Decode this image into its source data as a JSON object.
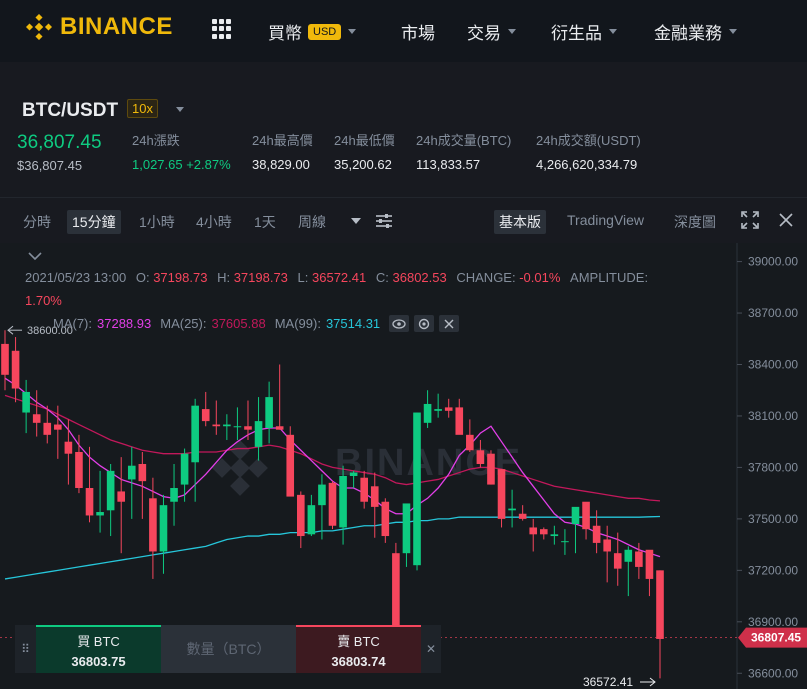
{
  "header": {
    "brand": "BINANCE",
    "nav": [
      {
        "label": "買幣",
        "badge": "USD",
        "has_caret": true
      },
      {
        "label": "市場",
        "has_caret": false
      },
      {
        "label": "交易",
        "has_caret": true
      },
      {
        "label": "衍生品",
        "has_caret": true
      },
      {
        "label": "金融業務",
        "has_caret": true
      }
    ]
  },
  "ticker": {
    "pair": "BTC/USDT",
    "leverage": "10x",
    "last_price": "36,807.45",
    "last_price_usd": "$36,807.45",
    "stats": [
      {
        "label": "24h漲跌",
        "value": "1,027.65 +2.87%",
        "color": "#0ecb81"
      },
      {
        "label": "24h最高價",
        "value": "38,829.00"
      },
      {
        "label": "24h最低價",
        "value": "35,200.62"
      },
      {
        "label": "24h成交量(BTC)",
        "value": "113,833.57"
      },
      {
        "label": "24h成交額(USDT)",
        "value": "4,266,620,334.79"
      }
    ]
  },
  "toolbar": {
    "intervals": [
      "分時",
      "15分鐘",
      "1小時",
      "4小時",
      "1天",
      "周線"
    ],
    "active_interval": "15分鐘",
    "views": [
      "基本版",
      "TradingView",
      "深度圖"
    ],
    "active_view": "基本版"
  },
  "ohlc": {
    "datetime": "2021/05/23 13:00",
    "o_label": "O:",
    "o": "37198.73",
    "h_label": "H:",
    "h": "37198.73",
    "l_label": "L:",
    "l": "36572.41",
    "c_label": "C:",
    "c": "36802.53",
    "change_label": "CHANGE:",
    "change": "-0.01%",
    "amplitude_label": "AMPLITUDE:",
    "amplitude": "1.70%"
  },
  "ma": [
    {
      "label": "MA(7):",
      "value": "37288.93",
      "color": "#e23fe8"
    },
    {
      "label": "MA(25):",
      "value": "37605.88",
      "color": "#c2185b"
    },
    {
      "label": "MA(99):",
      "value": "37514.31",
      "color": "#26c6da"
    }
  ],
  "chart_data": {
    "type": "candlestick",
    "y_ticks": [
      "39000.00",
      "38700.00",
      "38400.00",
      "38100.00",
      "37800.00",
      "37500.00",
      "37200.00",
      "36900.00",
      "36600.00"
    ],
    "ylim": [
      36450,
      39050
    ],
    "current_price_label": "36807.45",
    "high_marker": "38600.00",
    "low_marker": "36572.41",
    "watermark": "BINANCE",
    "candles": [
      [
        38520,
        38600,
        38250,
        38340
      ],
      [
        38480,
        38560,
        38180,
        38260
      ],
      [
        38120,
        38310,
        38000,
        38240
      ],
      [
        38110,
        38250,
        37980,
        38060
      ],
      [
        38060,
        38160,
        37940,
        37990
      ],
      [
        38050,
        38160,
        37850,
        38020
      ],
      [
        37950,
        38080,
        37700,
        37880
      ],
      [
        37890,
        37990,
        37650,
        37680
      ],
      [
        37680,
        37920,
        37480,
        37520
      ],
      [
        37520,
        37780,
        37420,
        37540
      ],
      [
        37550,
        37820,
        37400,
        37780
      ],
      [
        37660,
        37860,
        37300,
        37600
      ],
      [
        37730,
        37920,
        37500,
        37810
      ],
      [
        37820,
        37890,
        37500,
        37720
      ],
      [
        37620,
        37740,
        37150,
        37310
      ],
      [
        37310,
        37640,
        37180,
        37580
      ],
      [
        37600,
        37820,
        37460,
        37680
      ],
      [
        37700,
        37910,
        37600,
        37880
      ],
      [
        37830,
        38200,
        37600,
        38160
      ],
      [
        38140,
        38240,
        38040,
        38070
      ],
      [
        38050,
        38190,
        37990,
        38040
      ],
      [
        38040,
        38110,
        37960,
        38050
      ],
      [
        38040,
        38150,
        37960,
        38040
      ],
      [
        38040,
        38190,
        37960,
        38020
      ],
      [
        37920,
        38210,
        37840,
        38070
      ],
      [
        38030,
        38300,
        37940,
        38210
      ],
      [
        38040,
        38400,
        38020,
        38020
      ],
      [
        37990,
        38040,
        37640,
        37630
      ],
      [
        37640,
        37660,
        37330,
        37400
      ],
      [
        37410,
        37640,
        37400,
        37580
      ],
      [
        37580,
        37760,
        37380,
        37700
      ],
      [
        37710,
        37720,
        37440,
        37460
      ],
      [
        37450,
        37810,
        37350,
        37750
      ],
      [
        37750,
        37780,
        37680,
        37770
      ],
      [
        37740,
        37780,
        37560,
        37600
      ],
      [
        37690,
        37770,
        37390,
        37570
      ],
      [
        37600,
        37620,
        37360,
        37400
      ],
      [
        37300,
        37360,
        36620,
        36800
      ],
      [
        37300,
        37560,
        37220,
        37590
      ],
      [
        37230,
        38120,
        37200,
        38120
      ],
      [
        38060,
        38250,
        38030,
        38170
      ],
      [
        38130,
        38230,
        38090,
        38140
      ],
      [
        38150,
        38200,
        38090,
        38130
      ],
      [
        38150,
        38200,
        38080,
        37990
      ],
      [
        37990,
        38080,
        37890,
        37900
      ],
      [
        37900,
        37960,
        37800,
        37820
      ],
      [
        37880,
        37900,
        37700,
        37700
      ],
      [
        37790,
        37790,
        37450,
        37500
      ],
      [
        37550,
        37670,
        37450,
        37560
      ],
      [
        37530,
        37580,
        37490,
        37500
      ],
      [
        37450,
        37500,
        37310,
        37410
      ],
      [
        37440,
        37450,
        37380,
        37410
      ],
      [
        37400,
        37460,
        37350,
        37410
      ],
      [
        37370,
        37440,
        37290,
        37370
      ],
      [
        37470,
        37500,
        37300,
        37570
      ],
      [
        37600,
        37500,
        37380,
        37440
      ],
      [
        37460,
        37550,
        37300,
        37360
      ],
      [
        37380,
        37460,
        37130,
        37310
      ],
      [
        37300,
        37420,
        37110,
        37210
      ],
      [
        37250,
        37340,
        37050,
        37320
      ],
      [
        37310,
        37360,
        37150,
        37220
      ],
      [
        37320,
        37300,
        37050,
        37150
      ],
      [
        37200,
        37200,
        36570,
        36800
      ]
    ],
    "ma7": [
      38320,
      38280,
      38230,
      38180,
      38140,
      38090,
      38020,
      37930,
      37860,
      37810,
      37770,
      37730,
      37710,
      37690,
      37660,
      37630,
      37620,
      37640,
      37700,
      37760,
      37830,
      37900,
      37950,
      37990,
      38020,
      38030,
      38030,
      37960,
      37900,
      37840,
      37780,
      37720,
      37680,
      37680,
      37650,
      37610,
      37560,
      37530,
      37530,
      37580,
      37620,
      37680,
      37760,
      37870,
      37930,
      38000,
      38040,
      37950,
      37860,
      37770,
      37690,
      37610,
      37530,
      37480,
      37470,
      37450,
      37420,
      37400,
      37380,
      37350,
      37320,
      37300,
      37280
    ],
    "ma25": [
      38220,
      38200,
      38180,
      38160,
      38140,
      38110,
      38080,
      38050,
      38020,
      37990,
      37960,
      37940,
      37920,
      37900,
      37890,
      37880,
      37880,
      37880,
      37890,
      37890,
      37890,
      37900,
      37910,
      37910,
      37920,
      37930,
      37920,
      37900,
      37880,
      37850,
      37820,
      37800,
      37790,
      37780,
      37770,
      37760,
      37740,
      37710,
      37700,
      37710,
      37720,
      37730,
      37750,
      37770,
      37790,
      37800,
      37800,
      37790,
      37770,
      37750,
      37730,
      37710,
      37690,
      37680,
      37670,
      37660,
      37650,
      37640,
      37630,
      37620,
      37620,
      37610,
      37605
    ],
    "ma99": [
      37150,
      37160,
      37170,
      37180,
      37190,
      37200,
      37210,
      37220,
      37230,
      37240,
      37250,
      37260,
      37270,
      37280,
      37290,
      37300,
      37310,
      37320,
      37330,
      37340,
      37360,
      37380,
      37390,
      37400,
      37400,
      37410,
      37410,
      37420,
      37420,
      37420,
      37430,
      37430,
      37440,
      37450,
      37460,
      37460,
      37470,
      37480,
      37480,
      37490,
      37490,
      37500,
      37500,
      37510,
      37510,
      37510,
      37510,
      37510,
      37510,
      37510,
      37510,
      37510,
      37510,
      37510,
      37510,
      37510,
      37510,
      37510,
      37510,
      37510,
      37510,
      37512,
      37514
    ]
  },
  "order_bar": {
    "buy_label": "買 BTC",
    "buy_price": "36803.75",
    "qty_placeholder": "數量（BTC）",
    "sell_label": "賣 BTC",
    "sell_price": "36803.74"
  }
}
